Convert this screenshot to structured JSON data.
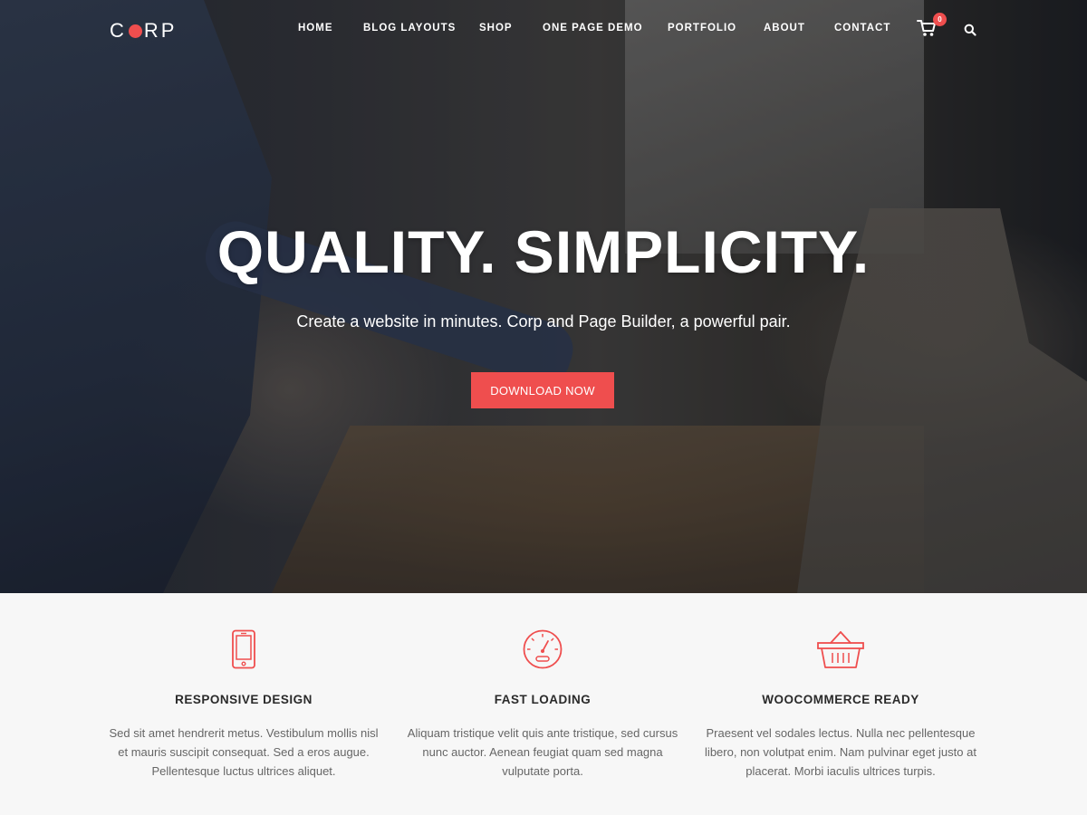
{
  "brand": {
    "logo_left": "C",
    "logo_right": "RP",
    "accent_color": "#ef4e4e"
  },
  "nav": {
    "items": [
      {
        "label": "HOME"
      },
      {
        "label": "BLOG LAYOUTS"
      },
      {
        "label": "SHOP"
      },
      {
        "label": "ONE PAGE DEMO"
      },
      {
        "label": "PORTFOLIO"
      },
      {
        "label": "ABOUT"
      },
      {
        "label": "CONTACT"
      }
    ],
    "cart_count": "0",
    "cart_icon": "cart-icon",
    "search_icon": "search-icon"
  },
  "hero": {
    "title": "QUALITY. SIMPLICITY.",
    "subtitle": "Create a website in minutes. Corp and Page Builder, a powerful pair.",
    "cta_label": "DOWNLOAD NOW"
  },
  "features": [
    {
      "icon": "smartphone-icon",
      "title": "RESPONSIVE DESIGN",
      "text": "Sed sit amet hendrerit metus. Vestibulum mollis nisl et mauris suscipit consequat. Sed a eros augue. Pellentesque luctus ultrices aliquet."
    },
    {
      "icon": "speedometer-icon",
      "title": "FAST LOADING",
      "text": "Aliquam tristique velit quis ante tristique, sed cursus nunc auctor. Aenean feugiat quam sed magna vulputate porta."
    },
    {
      "icon": "basket-icon",
      "title": "WOOCOMMERCE READY",
      "text": "Praesent vel sodales lectus. Nulla nec pellentesque libero, non volutpat enim. Nam pulvinar eget justo at placerat. Morbi iaculis ultrices turpis."
    }
  ]
}
